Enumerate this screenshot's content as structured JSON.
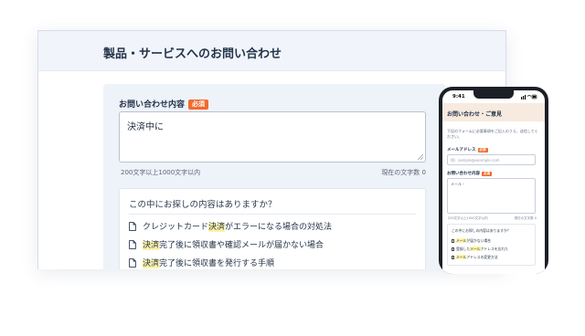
{
  "desktop": {
    "title": "製品・サービスへのお問い合わせ",
    "field_label": "お問い合わせ内容",
    "required_badge": "必須",
    "textarea_value": "決済中に",
    "hint_left": "200文字以上1000文字以内",
    "hint_right": "現在の文字数 0",
    "suggest_title": "この中にお探しの内容はありますか？",
    "suggestions": [
      {
        "pre": "クレジットカード",
        "hl": "決済",
        "post": "がエラーになる場合の対処法"
      },
      {
        "pre": "",
        "hl": "決済",
        "post": "完了後に領収書や確認メールが届かない場合"
      },
      {
        "pre": "",
        "hl": "決済",
        "post": "完了後に領収書を発行する手順"
      }
    ]
  },
  "phone": {
    "time": "9:41",
    "title": "お問い合わせ・ご意見",
    "intro": "下記のフォームに必要事項をご記入のうえ、送信してください。",
    "email_label": "メールアドレス",
    "email_required": "必須",
    "email_placeholder": "例）sample@example.com",
    "content_label": "お問い合わせ内容",
    "content_required": "必須",
    "content_value": "メール・",
    "hint_left": "200文字以上1000文字以内",
    "hint_right": "現在の文字数 0",
    "suggest_title": "この中にお探しの内容はありますか？",
    "suggestions": [
      {
        "pre": "",
        "hl": "メール",
        "post": "が届かない場合"
      },
      {
        "pre": "登録した",
        "hl": "メール",
        "post": "アドレスを忘れた"
      },
      {
        "pre": "",
        "hl": "メール",
        "post": "アドレスの変更方法"
      }
    ]
  },
  "colors": {
    "required": "#f26a2e",
    "highlight": "#fff3a8",
    "header_bg": "#f1f4fb",
    "phone_header_bg": "#f7eadf"
  }
}
